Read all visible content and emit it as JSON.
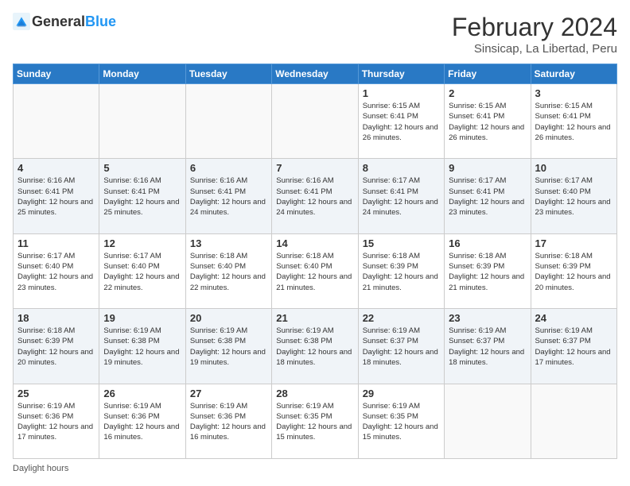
{
  "header": {
    "logo_general": "General",
    "logo_blue": "Blue",
    "month_year": "February 2024",
    "location": "Sinsicap, La Libertad, Peru"
  },
  "days_of_week": [
    "Sunday",
    "Monday",
    "Tuesday",
    "Wednesday",
    "Thursday",
    "Friday",
    "Saturday"
  ],
  "weeks": [
    [
      {
        "day": "",
        "info": ""
      },
      {
        "day": "",
        "info": ""
      },
      {
        "day": "",
        "info": ""
      },
      {
        "day": "",
        "info": ""
      },
      {
        "day": "1",
        "info": "Sunrise: 6:15 AM\nSunset: 6:41 PM\nDaylight: 12 hours and 26 minutes."
      },
      {
        "day": "2",
        "info": "Sunrise: 6:15 AM\nSunset: 6:41 PM\nDaylight: 12 hours and 26 minutes."
      },
      {
        "day": "3",
        "info": "Sunrise: 6:15 AM\nSunset: 6:41 PM\nDaylight: 12 hours and 26 minutes."
      }
    ],
    [
      {
        "day": "4",
        "info": "Sunrise: 6:16 AM\nSunset: 6:41 PM\nDaylight: 12 hours and 25 minutes."
      },
      {
        "day": "5",
        "info": "Sunrise: 6:16 AM\nSunset: 6:41 PM\nDaylight: 12 hours and 25 minutes."
      },
      {
        "day": "6",
        "info": "Sunrise: 6:16 AM\nSunset: 6:41 PM\nDaylight: 12 hours and 24 minutes."
      },
      {
        "day": "7",
        "info": "Sunrise: 6:16 AM\nSunset: 6:41 PM\nDaylight: 12 hours and 24 minutes."
      },
      {
        "day": "8",
        "info": "Sunrise: 6:17 AM\nSunset: 6:41 PM\nDaylight: 12 hours and 24 minutes."
      },
      {
        "day": "9",
        "info": "Sunrise: 6:17 AM\nSunset: 6:41 PM\nDaylight: 12 hours and 23 minutes."
      },
      {
        "day": "10",
        "info": "Sunrise: 6:17 AM\nSunset: 6:40 PM\nDaylight: 12 hours and 23 minutes."
      }
    ],
    [
      {
        "day": "11",
        "info": "Sunrise: 6:17 AM\nSunset: 6:40 PM\nDaylight: 12 hours and 23 minutes."
      },
      {
        "day": "12",
        "info": "Sunrise: 6:17 AM\nSunset: 6:40 PM\nDaylight: 12 hours and 22 minutes."
      },
      {
        "day": "13",
        "info": "Sunrise: 6:18 AM\nSunset: 6:40 PM\nDaylight: 12 hours and 22 minutes."
      },
      {
        "day": "14",
        "info": "Sunrise: 6:18 AM\nSunset: 6:40 PM\nDaylight: 12 hours and 21 minutes."
      },
      {
        "day": "15",
        "info": "Sunrise: 6:18 AM\nSunset: 6:39 PM\nDaylight: 12 hours and 21 minutes."
      },
      {
        "day": "16",
        "info": "Sunrise: 6:18 AM\nSunset: 6:39 PM\nDaylight: 12 hours and 21 minutes."
      },
      {
        "day": "17",
        "info": "Sunrise: 6:18 AM\nSunset: 6:39 PM\nDaylight: 12 hours and 20 minutes."
      }
    ],
    [
      {
        "day": "18",
        "info": "Sunrise: 6:18 AM\nSunset: 6:39 PM\nDaylight: 12 hours and 20 minutes."
      },
      {
        "day": "19",
        "info": "Sunrise: 6:19 AM\nSunset: 6:38 PM\nDaylight: 12 hours and 19 minutes."
      },
      {
        "day": "20",
        "info": "Sunrise: 6:19 AM\nSunset: 6:38 PM\nDaylight: 12 hours and 19 minutes."
      },
      {
        "day": "21",
        "info": "Sunrise: 6:19 AM\nSunset: 6:38 PM\nDaylight: 12 hours and 18 minutes."
      },
      {
        "day": "22",
        "info": "Sunrise: 6:19 AM\nSunset: 6:37 PM\nDaylight: 12 hours and 18 minutes."
      },
      {
        "day": "23",
        "info": "Sunrise: 6:19 AM\nSunset: 6:37 PM\nDaylight: 12 hours and 18 minutes."
      },
      {
        "day": "24",
        "info": "Sunrise: 6:19 AM\nSunset: 6:37 PM\nDaylight: 12 hours and 17 minutes."
      }
    ],
    [
      {
        "day": "25",
        "info": "Sunrise: 6:19 AM\nSunset: 6:36 PM\nDaylight: 12 hours and 17 minutes."
      },
      {
        "day": "26",
        "info": "Sunrise: 6:19 AM\nSunset: 6:36 PM\nDaylight: 12 hours and 16 minutes."
      },
      {
        "day": "27",
        "info": "Sunrise: 6:19 AM\nSunset: 6:36 PM\nDaylight: 12 hours and 16 minutes."
      },
      {
        "day": "28",
        "info": "Sunrise: 6:19 AM\nSunset: 6:35 PM\nDaylight: 12 hours and 15 minutes."
      },
      {
        "day": "29",
        "info": "Sunrise: 6:19 AM\nSunset: 6:35 PM\nDaylight: 12 hours and 15 minutes."
      },
      {
        "day": "",
        "info": ""
      },
      {
        "day": "",
        "info": ""
      }
    ]
  ],
  "footer": {
    "daylight_label": "Daylight hours"
  }
}
